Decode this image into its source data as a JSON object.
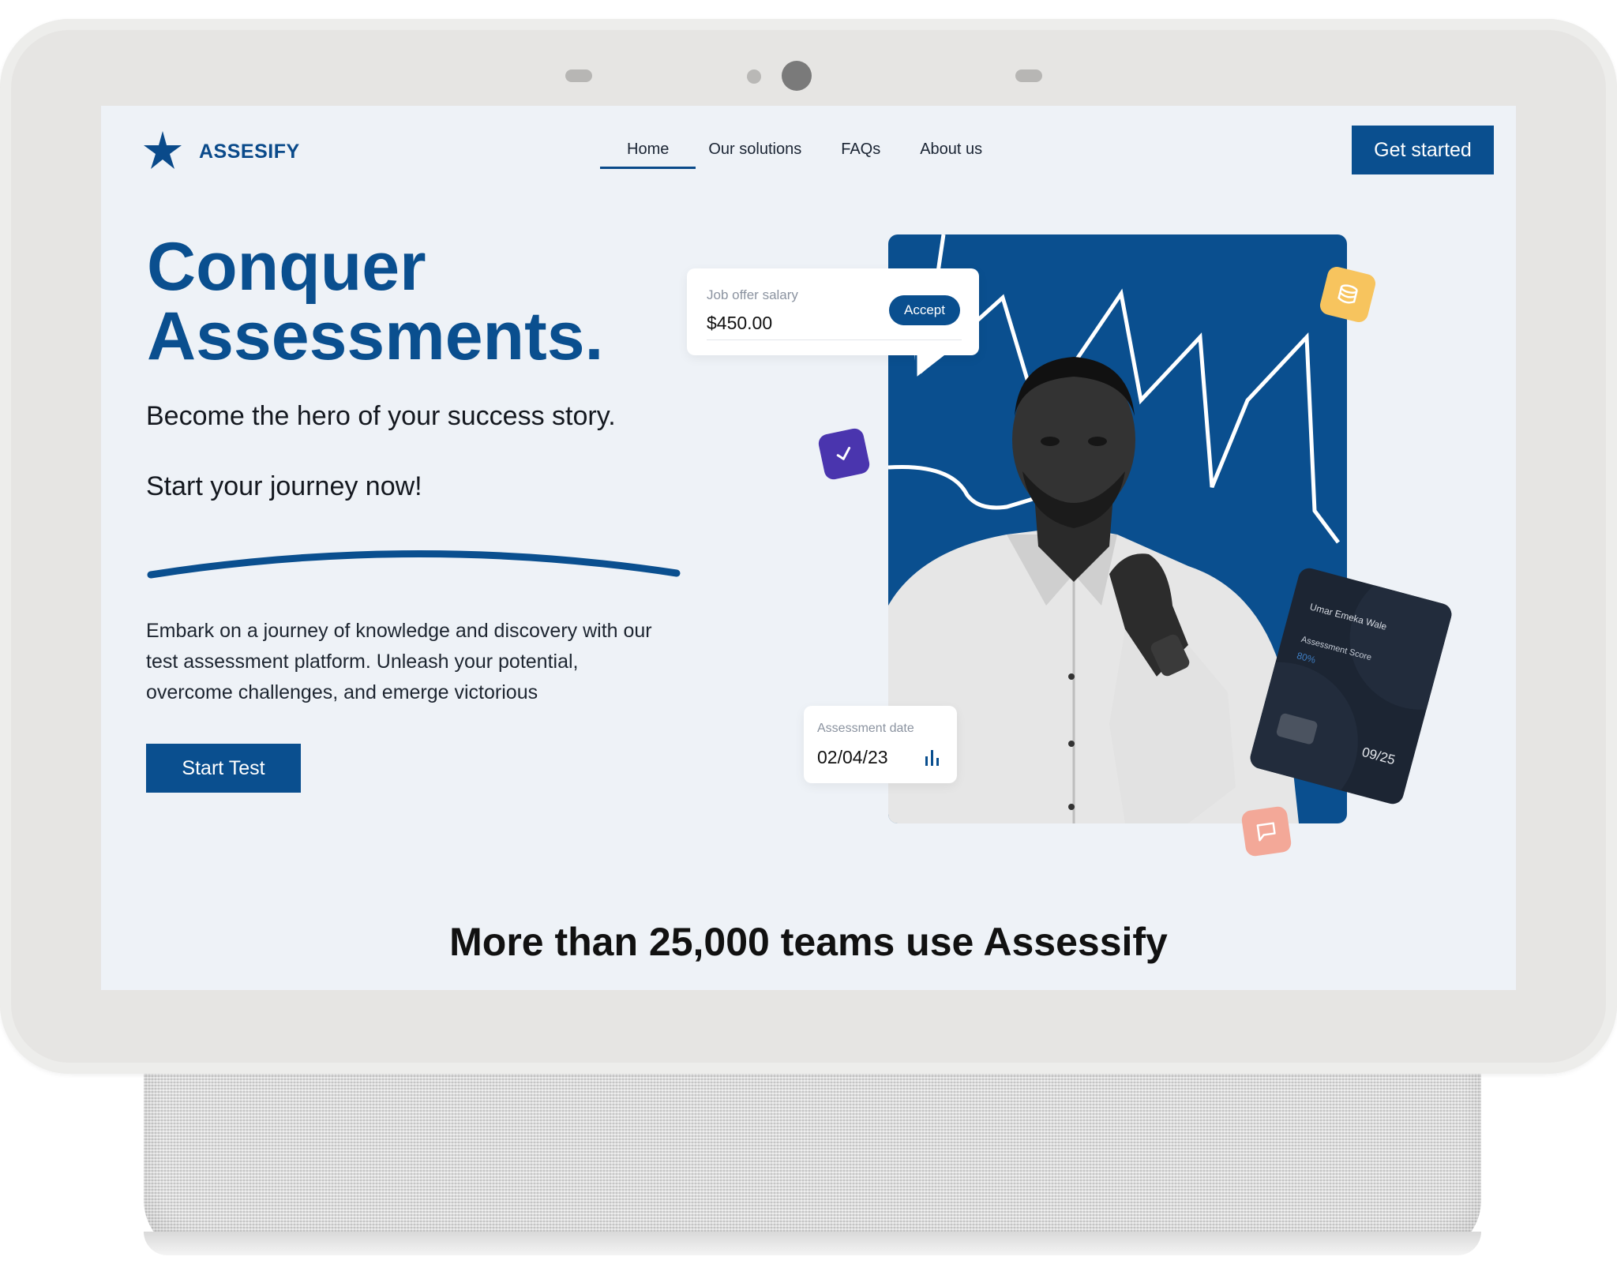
{
  "brand": {
    "name": "ASSESIFY"
  },
  "nav": {
    "items": [
      {
        "label": "Home",
        "active": true
      },
      {
        "label": "Our solutions",
        "active": false
      },
      {
        "label": "FAQs",
        "active": false
      },
      {
        "label": "About us",
        "active": false
      }
    ],
    "cta_label": "Get started"
  },
  "hero": {
    "title_line1": "Conquer",
    "title_line2": "Assessments.",
    "tagline": "Become the hero of your success story.",
    "tagline2": "Start your journey now!",
    "body": "Embark on a journey of knowledge and discovery with our test assessment platform. Unleash your potential, overcome challenges, and emerge victorious",
    "start_label": "Start Test"
  },
  "salary_card": {
    "label": "Job offer salary",
    "value": "$450.00",
    "accept_label": "Accept"
  },
  "date_card": {
    "label": "Assessment date",
    "value": "02/04/23"
  },
  "score_card": {
    "name": "Umar Emeka Wale",
    "label": "Assessment Score",
    "value": "80%",
    "expiry": "09/25"
  },
  "footer": {
    "headline": "More than 25,000 teams use Assessify"
  },
  "colors": {
    "primary": "#0a4f8f",
    "background": "#eef2f7",
    "accent_yellow": "#f7c45e",
    "accent_purple": "#4a35ae",
    "accent_salmon": "#f3a898",
    "card_dark": "#1c2533"
  },
  "icons": [
    "star-logo-icon",
    "database-icon",
    "check-icon",
    "chat-icon",
    "bar-chart-icon"
  ]
}
